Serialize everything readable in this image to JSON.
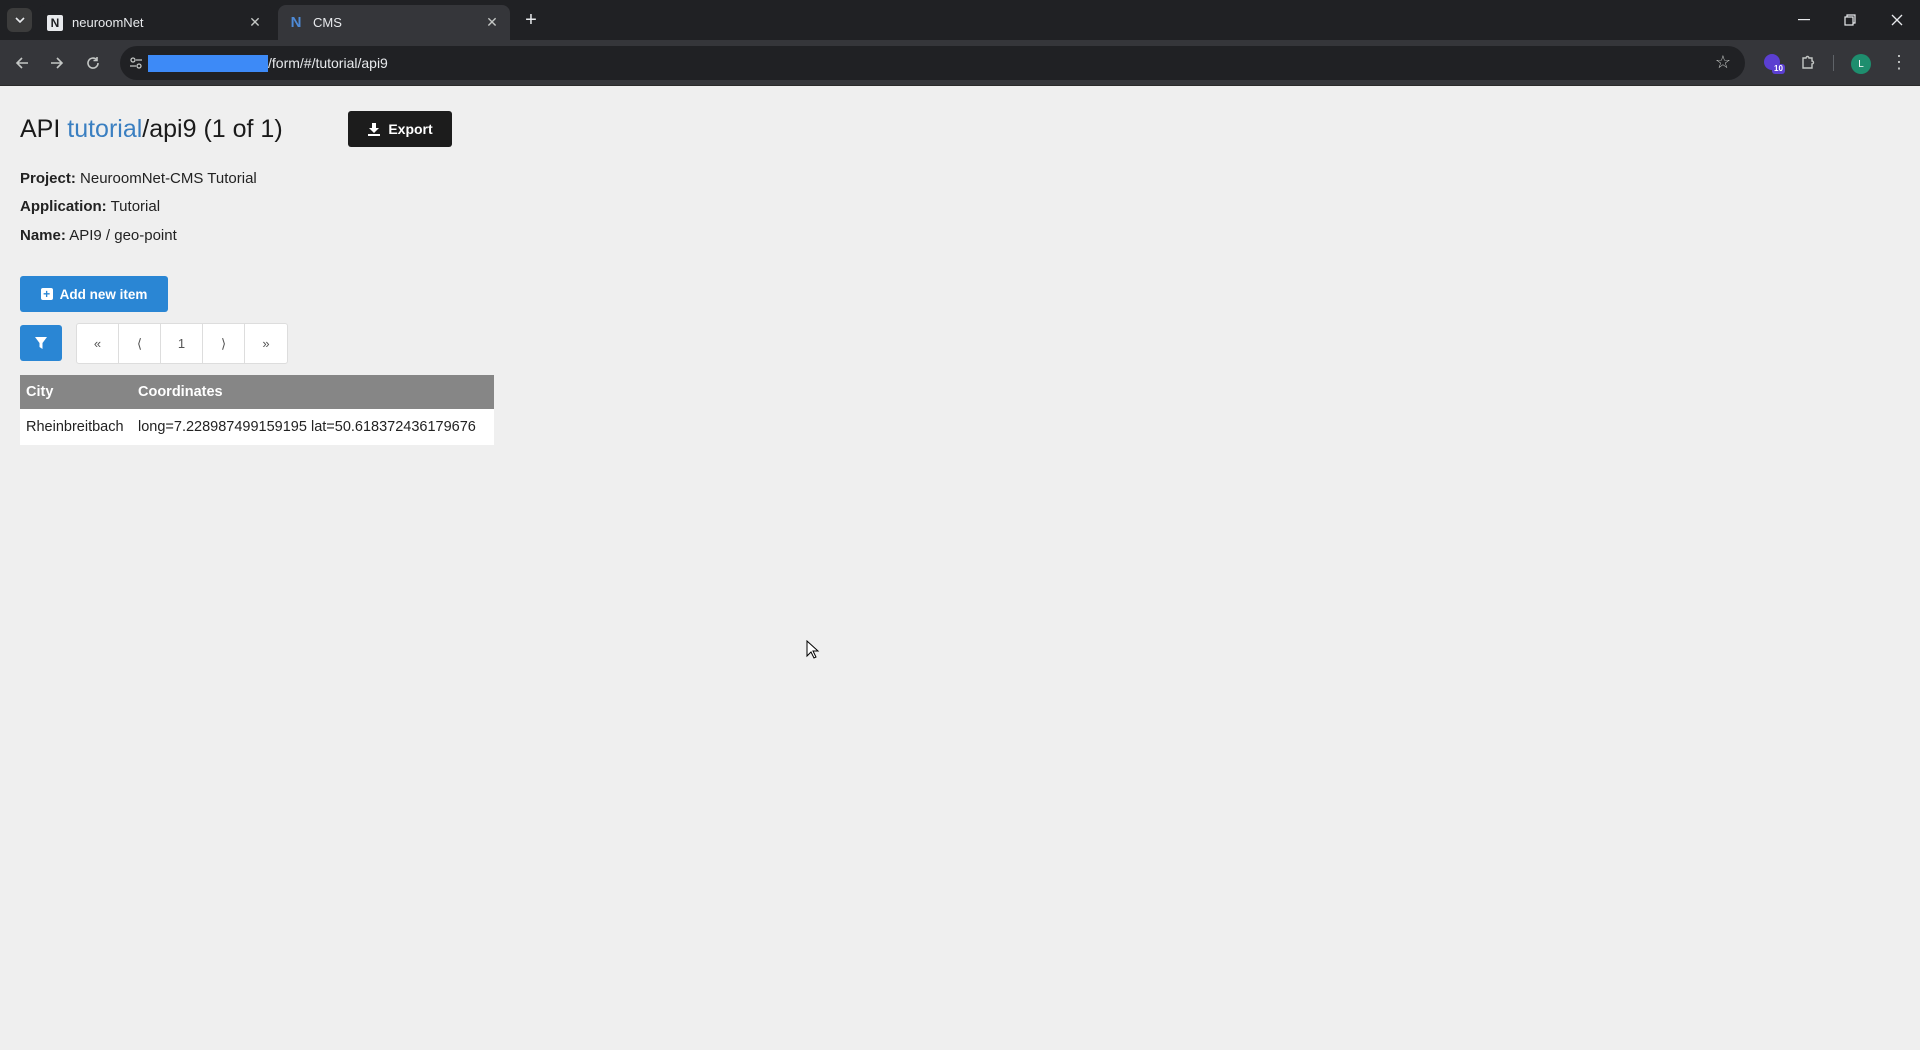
{
  "browser": {
    "tabs": [
      {
        "title": "neuroomNet",
        "favicon": "N"
      },
      {
        "title": "CMS",
        "favicon": "N"
      }
    ],
    "url_visible": "/form/#/tutorial/api9",
    "extension_badge": "10",
    "profile_initial": "L"
  },
  "page": {
    "title_prefix": "API ",
    "title_link": "tutorial",
    "title_suffix": "/api9 (1 of 1)",
    "export_label": "Export",
    "project_label": "Project:",
    "project_value": "NeuroomNet-CMS Tutorial",
    "application_label": "Application:",
    "application_value": "Tutorial",
    "name_label": "Name:",
    "name_value": "API9 / geo-point",
    "add_label": "Add new item"
  },
  "pager": {
    "first": "«",
    "prev": "⟨",
    "current": "1",
    "next": "⟩",
    "last": "»"
  },
  "table": {
    "headers": [
      "City",
      "Coordinates"
    ],
    "rows": [
      [
        "Rheinbreitbach",
        "long=7.228987499159195 lat=50.618372436179676"
      ]
    ]
  },
  "colors": {
    "accent": "#2a86d4",
    "link": "#3a7fc1",
    "header_bg": "#868686",
    "dark_button": "#1c1c1c"
  }
}
